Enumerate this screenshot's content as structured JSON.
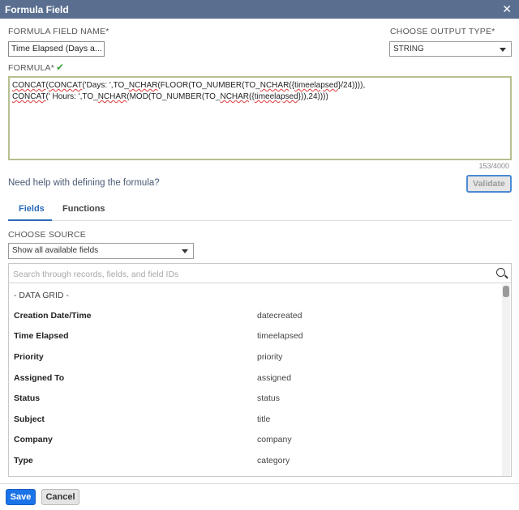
{
  "dialog": {
    "title": "Formula Field",
    "close_glyph": "✕"
  },
  "name_field": {
    "label": "FORMULA FIELD NAME*",
    "value": "Time Elapsed (Days a..."
  },
  "output_type": {
    "label": "CHOOSE OUTPUT TYPE*",
    "value": "STRING"
  },
  "formula": {
    "label": "FORMULA*",
    "valid_icon": "✔",
    "line1": "CONCAT(CONCAT('Days: ',TO_NCHAR(FLOOR(TO_NUMBER(TO_NCHAR({timeelapsed}/24)))),",
    "line2": "CONCAT(' Hours: ',TO_NCHAR(MOD(TO_NUMBER(TO_NCHAR({timeelapsed})),24))))",
    "char_count": "153/4000"
  },
  "help_text": "Need help with defining the formula?",
  "validate_label": "Validate",
  "tabs": [
    {
      "label": "Fields"
    },
    {
      "label": "Functions"
    }
  ],
  "source": {
    "label": "CHOOSE SOURCE",
    "value": "Show all available fields"
  },
  "search": {
    "placeholder": "Search through records, fields, and field IDs"
  },
  "group": "- DATA GRID -",
  "fields": [
    {
      "name": "Creation Date/Time",
      "id": "datecreated"
    },
    {
      "name": "Time Elapsed",
      "id": "timeelapsed"
    },
    {
      "name": "Priority",
      "id": "priority"
    },
    {
      "name": "Assigned To",
      "id": "assigned"
    },
    {
      "name": "Status",
      "id": "status"
    },
    {
      "name": "Subject",
      "id": "title"
    },
    {
      "name": "Company",
      "id": "company"
    },
    {
      "name": "Type",
      "id": "category"
    }
  ],
  "footer": {
    "save": "Save",
    "cancel": "Cancel"
  },
  "colors": {
    "titlebar": "#5a6f90",
    "accent": "#2a6ab8",
    "save": "#1a73e8"
  }
}
